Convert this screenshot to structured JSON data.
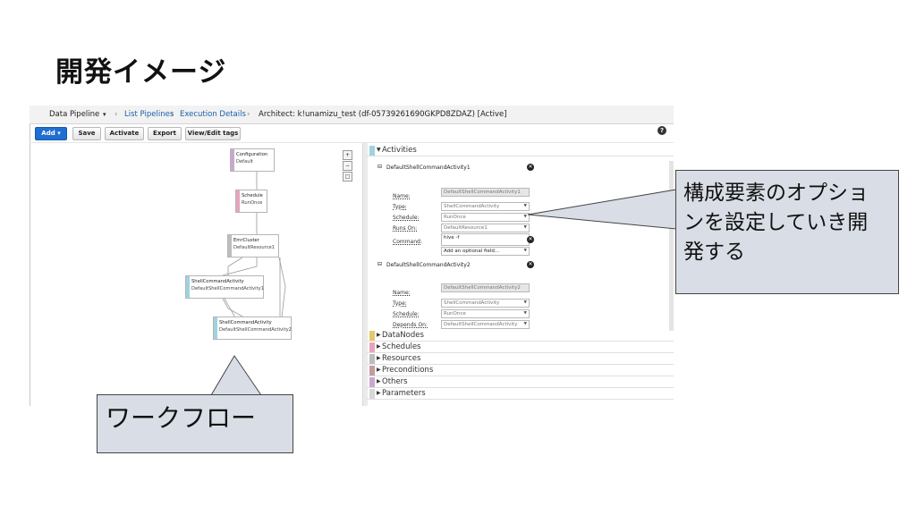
{
  "slide": {
    "title": "開発イメージ"
  },
  "nav": {
    "app": "Data Pipeline",
    "app_caret": "▾",
    "sep": "›",
    "list": "List Pipelines",
    "exec": "Execution Details",
    "current": "Architect: k!unamizu_test (df-05739261690GKPD8ZDAZ) [Active]"
  },
  "toolbar": {
    "add": "Add",
    "add_caret": "▾",
    "save": "Save",
    "activate": "Activate",
    "export": "Export",
    "view_edit": "View/Edit tags",
    "help": "?"
  },
  "canvas": {
    "zoom_in": "+",
    "zoom_out": "−",
    "zoom_fit": "□",
    "nodes": [
      {
        "type": "Configuration",
        "name": "Default",
        "color": "#c9a8d0"
      },
      {
        "type": "Schedule",
        "name": "RunOnce",
        "color": "#e8a3bd"
      },
      {
        "type": "EmrCluster",
        "name": "DefaultResource1",
        "color": "#bdbdbd"
      },
      {
        "type": "ShellCommandActivity",
        "name": "DefaultShellCommandActivity1",
        "color": "#9fd3df"
      },
      {
        "type": "ShellCommandActivity",
        "name": "DefaultShellCommandActivity2",
        "color": "#9fd3df"
      }
    ]
  },
  "panel": {
    "activities_label": "Activities",
    "activity1": {
      "header": "DefaultShellCommandActivity1",
      "fields": [
        {
          "label": "Name:",
          "value": "DefaultShellCommandActivity1"
        },
        {
          "label": "Type:",
          "value": "ShellCommandActivity"
        },
        {
          "label": "Schedule:",
          "value": "RunOnce"
        },
        {
          "label": "Runs On:",
          "value": "DefaultResource1"
        },
        {
          "label": "Command:",
          "value": "hive -f"
        }
      ],
      "add_field": "Add an optional field..."
    },
    "activity2": {
      "header": "DefaultShellCommandActivity2",
      "fields": [
        {
          "label": "Name:",
          "value": "DefaultShellCommandActivity2"
        },
        {
          "label": "Type:",
          "value": "ShellCommandActivity"
        },
        {
          "label": "Schedule:",
          "value": "RunOnce"
        },
        {
          "label": "Depends On:",
          "value": "DefaultShellCommandActivity"
        }
      ]
    },
    "categories": [
      {
        "label": "DataNodes",
        "color": "#e4c86a"
      },
      {
        "label": "Schedules",
        "color": "#e8a3bd"
      },
      {
        "label": "Resources",
        "color": "#bdbdbd"
      },
      {
        "label": "Preconditions",
        "color": "#c79b9b"
      },
      {
        "label": "Others",
        "color": "#c9a8d0"
      },
      {
        "label": "Parameters",
        "color": "#d7d7d7"
      }
    ],
    "activities_color": "#9fd3df"
  },
  "callouts": {
    "settings": "構成要素のオプションを設定していき開発する",
    "workflow": "ワークフロー"
  }
}
